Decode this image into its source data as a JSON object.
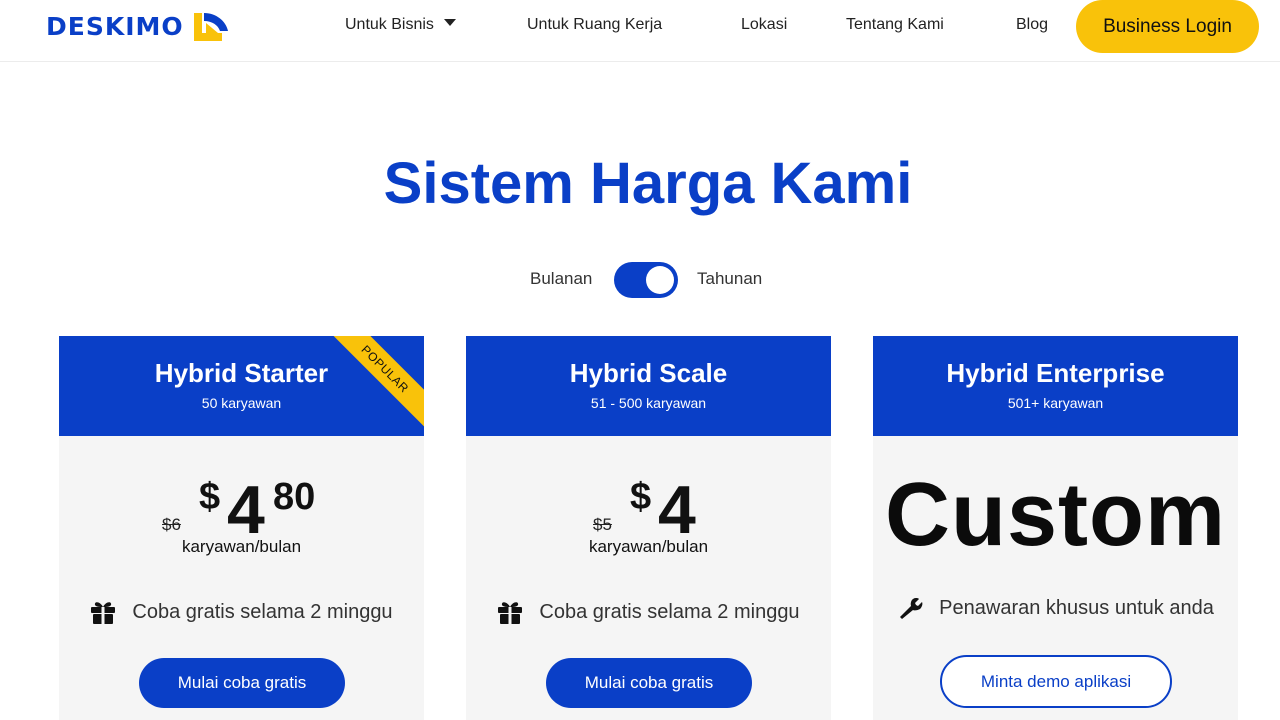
{
  "header": {
    "logo_text": "DESKIMO",
    "nav": [
      {
        "label": "Untuk Bisnis",
        "has_dropdown": true
      },
      {
        "label": "Untuk Ruang Kerja"
      },
      {
        "label": "Lokasi"
      },
      {
        "label": "Tentang Kami"
      },
      {
        "label": "Blog"
      }
    ],
    "login_label": "Business Login"
  },
  "pricing": {
    "title": "Sistem Harga Kami",
    "toggle": {
      "left_label": "Bulanan",
      "right_label": "Tahunan",
      "selected": "Tahunan"
    },
    "plans": [
      {
        "name": "Hybrid Starter",
        "employees": "50 karyawan",
        "badge": "POPULAR",
        "old_price": "$6",
        "currency": "$",
        "price_main": "4",
        "price_cents": "80",
        "per": "karyawan/bulan",
        "feature": "Coba gratis selama 2 minggu",
        "feature_icon": "gift-icon",
        "cta": "Mulai coba gratis"
      },
      {
        "name": "Hybrid Scale",
        "employees": "51 - 500 karyawan",
        "old_price": "$5",
        "currency": "$",
        "price_main": "4",
        "per": "karyawan/bulan",
        "feature": "Coba gratis selama 2 minggu",
        "feature_icon": "gift-icon",
        "cta": "Mulai coba gratis"
      },
      {
        "name": "Hybrid Enterprise",
        "employees": "501+ karyawan",
        "price_text": "Custom",
        "feature": "Penawaran khusus untuk anda",
        "feature_icon": "wrench-icon",
        "cta": "Minta demo aplikasi"
      }
    ]
  },
  "colors": {
    "brand_blue": "#0a3fc7",
    "accent_yellow": "#f9c20a",
    "card_bg": "#f5f5f5"
  }
}
